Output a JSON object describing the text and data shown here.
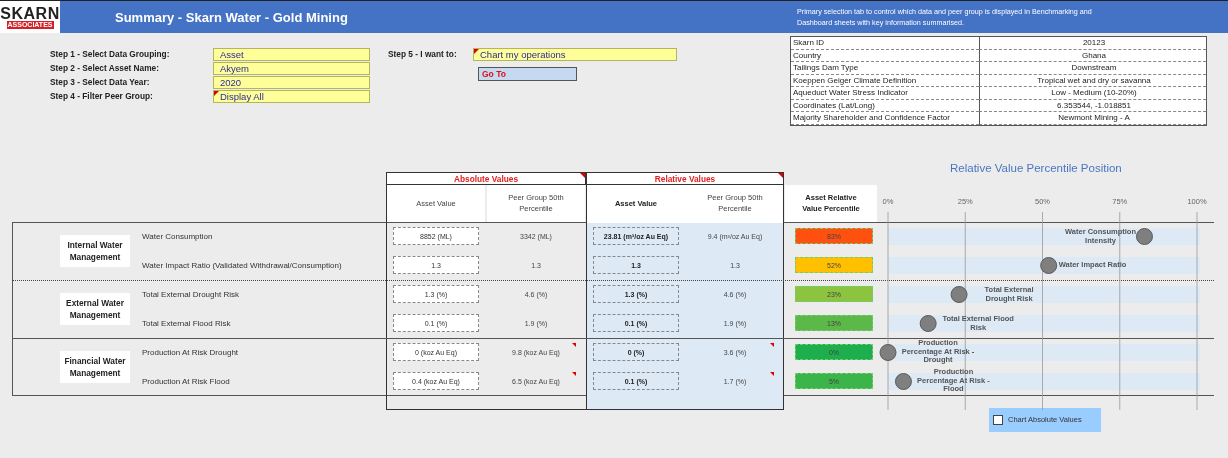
{
  "header": {
    "logo_top": "SKARN",
    "logo_bottom": "ASSOCIATES",
    "title": "Summary - Skarn Water - Gold Mining",
    "description": "Primary selection tab to control which data and peer group is displayed in Benchmarking and Dashboard sheets with key information summarised."
  },
  "steps": [
    {
      "label": "Step 1 - Select Data Grouping:",
      "value": "Asset",
      "note": false
    },
    {
      "label": "Step 2 - Select Asset Name:",
      "value": "Akyem",
      "note": false
    },
    {
      "label": "Step 3 - Select Data Year:",
      "value": "2020",
      "note": false
    },
    {
      "label": "Step 4 - Filter Peer Group:",
      "value": "Display All",
      "note": true
    }
  ],
  "action": {
    "label": "Step 5 - I want to:",
    "value": "Chart my operations",
    "note": true,
    "button": "Go To"
  },
  "info": [
    {
      "key": "Skarn ID",
      "value": "20123"
    },
    {
      "key": "Country",
      "value": "Ghana"
    },
    {
      "key": "Tailings Dam Type",
      "value": "Downstream"
    },
    {
      "key": "Koeppen Geiger Climate Definition",
      "value": "Tropical wet and dry or savanna"
    },
    {
      "key": "Aqueduct Water Stress Indicator",
      "value": "Low - Medium (10-20%)"
    },
    {
      "key": "Coordinates (Lat/Long)",
      "value": "6.353544, -1.018851"
    },
    {
      "key": "Majority Shareholder and Confidence Factor",
      "value": "Newmont Mining - A"
    }
  ],
  "table": {
    "absolute_header": {
      "title": "Absolute Values",
      "note": true
    },
    "relative_header": {
      "title": "Relative Values",
      "note": true
    },
    "columns": [
      "Asset Value",
      "Peer Group 50th Percentile",
      "Asset Value",
      "Peer Group 50th Percentile",
      "Asset Relative Value Percentile"
    ],
    "groups": [
      {
        "name": "Internal Water Management",
        "rows": [
          {
            "metric": "Water Consumption",
            "abs_asset": "8852 (ML)",
            "abs_peer": "3342 (ML)",
            "rel_asset": "23.81 (m³/oz Au Eq)",
            "rel_peer": "9.4 (m³/oz Au Eq)",
            "percentile": "83%",
            "color": "#ff5010",
            "note": false
          },
          {
            "metric": "Water Impact Ratio (Validated Withdrawal/Consumption)",
            "abs_asset": "1.3",
            "abs_peer": "1.3",
            "rel_asset": "1.3",
            "rel_peer": "1.3",
            "percentile": "52%",
            "color": "#ffc000",
            "note": false
          }
        ]
      },
      {
        "name": "External Water Management",
        "rows": [
          {
            "metric": "Total External Drought Risk",
            "abs_asset": "1.3 (%)",
            "abs_peer": "4.6 (%)",
            "rel_asset": "1.3 (%)",
            "rel_peer": "4.6 (%)",
            "percentile": "23%",
            "color": "#8cc43f",
            "note": false
          },
          {
            "metric": "Total External Flood Risk",
            "abs_asset": "0.1 (%)",
            "abs_peer": "1.9 (%)",
            "rel_asset": "0.1 (%)",
            "rel_peer": "1.9 (%)",
            "percentile": "13%",
            "color": "#5cb848",
            "note": false
          }
        ]
      },
      {
        "name": "Financial Water Management",
        "rows": [
          {
            "metric": "Production At Risk Drought",
            "abs_asset": "0 (koz Au Eq)",
            "abs_peer": "9.8 (koz Au Eq)",
            "rel_asset": "0 (%)",
            "rel_peer": "3.6 (%)",
            "percentile": "0%",
            "color": "#1fae4e",
            "note": true
          },
          {
            "metric": "Production At Risk Flood",
            "abs_asset": "0.4 (koz Au Eq)",
            "abs_peer": "6.5 (koz Au Eq)",
            "rel_asset": "0.1 (%)",
            "rel_peer": "1.7 (%)",
            "percentile": "5%",
            "color": "#3bb44a",
            "note": true
          }
        ]
      }
    ]
  },
  "chart": {
    "chart_data": {
      "type": "scatter",
      "title": "Relative Value Percentile Position",
      "orientation": "horizontal",
      "categories": [
        "Water Consumption Intensity",
        "Water Impact Ratio",
        "Total External Drought Risk",
        "Total External Flood Risk",
        "Production Percentage At Risk - Drought",
        "Production Percentage At Risk - Flood"
      ],
      "values": [
        83,
        52,
        23,
        13,
        0,
        5
      ],
      "xlim": [
        0,
        100
      ],
      "grid": true,
      "xticks": [
        {
          "value": 0,
          "label": "0%"
        },
        {
          "value": 25,
          "label": "25%"
        },
        {
          "value": 50,
          "label": "50%"
        },
        {
          "value": 75,
          "label": "75%"
        },
        {
          "value": 100,
          "label": "100%"
        }
      ]
    }
  },
  "checkbox": {
    "label": "Chart Absolute Values",
    "checked": false
  }
}
